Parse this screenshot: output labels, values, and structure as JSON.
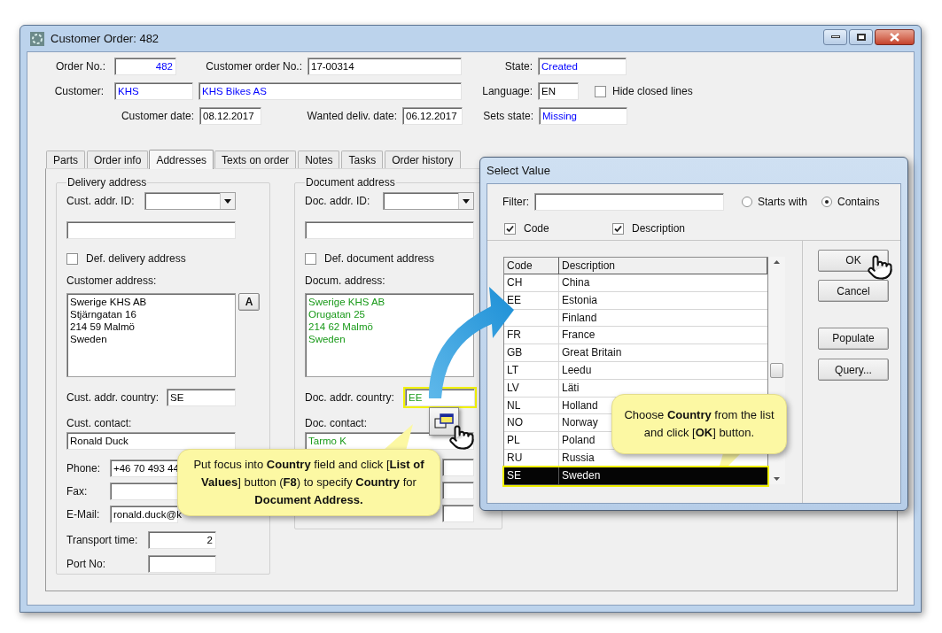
{
  "window": {
    "title": "Customer Order: 482"
  },
  "header": {
    "order_no": {
      "label": "Order No.:",
      "value": "482",
      "linked": true
    },
    "customer_order_no": {
      "label": "Customer order No.:",
      "value": "17-00314"
    },
    "state": {
      "label": "State:",
      "value": "Created",
      "linked": true
    },
    "customer": {
      "label": "Customer:",
      "code": "KHS",
      "name": "KHS Bikes AS",
      "linked": true
    },
    "language": {
      "label": "Language:",
      "value": "EN"
    },
    "hide_closed_lines": {
      "label": "Hide closed lines",
      "checked": false
    },
    "customer_date": {
      "label": "Customer date:",
      "value": "08.12.2017"
    },
    "wanted_delivery_date": {
      "label": "Wanted deliv. date:",
      "value": "06.12.2017"
    },
    "sets_state": {
      "label": "Sets state:",
      "value": "Missing",
      "linked": true
    }
  },
  "tabs": [
    {
      "label": "Parts",
      "selected": false
    },
    {
      "label": "Order info",
      "selected": false
    },
    {
      "label": "Addresses",
      "selected": true
    },
    {
      "label": "Texts on order",
      "selected": false
    },
    {
      "label": "Notes",
      "selected": false
    },
    {
      "label": "Tasks",
      "selected": false
    },
    {
      "label": "Order history",
      "selected": false
    }
  ],
  "delivery_address": {
    "title": "Delivery address",
    "addr_id": {
      "label": "Cust. addr. ID:"
    },
    "def_checkbox": {
      "label": "Def. delivery address",
      "checked": false
    },
    "address_label": "Customer address:",
    "address": {
      "lines": [
        "Swerige KHS AB",
        "Stjärngatan 16",
        "214 59 Malmö",
        "Sweden"
      ]
    },
    "address_button": "A",
    "country": {
      "label": "Cust. addr. country:",
      "value": "SE",
      "highlighted": false
    },
    "contact": {
      "label": "Cust. contact:",
      "value": "Ronald Duck"
    },
    "phone": {
      "label": "Phone:",
      "value": "+46 70 493 44"
    },
    "fax": {
      "label": "Fax:"
    },
    "email": {
      "label": "E-Mail:",
      "value": "ronald.duck@k"
    },
    "transport_time": {
      "label": "Transport time:",
      "value": "2"
    },
    "port_no": {
      "label": "Port No:"
    }
  },
  "document_address": {
    "title": "Document address",
    "addr_id": {
      "label": "Doc. addr. ID:"
    },
    "def_checkbox": {
      "label": "Def. document address",
      "checked": false
    },
    "address_label": "Docum. address:",
    "address": {
      "lines": [
        "Swerige KHS AB",
        "Orugatan 25",
        "214 62 Malmö",
        "Sweden"
      ],
      "inherited": true
    },
    "country": {
      "label": "Doc. addr. country:",
      "value": "EE",
      "inherited": true,
      "highlighted": true
    },
    "contact": {
      "label": "Doc. contact:",
      "value": "Tarmo K",
      "inherited": true
    }
  },
  "dialog": {
    "title": "Select Value",
    "filter": {
      "label": "Filter:"
    },
    "match_options": [
      {
        "label": "Starts with",
        "selected": false
      },
      {
        "label": "Contains",
        "selected": true
      }
    ],
    "search_in": [
      {
        "label": "Code",
        "checked": true
      },
      {
        "label": "Description",
        "checked": true
      }
    ],
    "table": {
      "columns": [
        "Code",
        "Description"
      ],
      "rows": [
        {
          "code": "CH",
          "description": "China",
          "selected": false
        },
        {
          "code": "EE",
          "description": "Estonia",
          "selected": false
        },
        {
          "description": "Finland",
          "selected": false
        },
        {
          "code": "FR",
          "description": "France",
          "selected": false
        },
        {
          "code": "GB",
          "description": "Great Britain",
          "selected": false
        },
        {
          "code": "LT",
          "description": "Leedu",
          "selected": false
        },
        {
          "code": "LV",
          "description": "Läti",
          "selected": false
        },
        {
          "code": "NL",
          "description": "Holland",
          "selected": false
        },
        {
          "code": "NO",
          "description": "Norway",
          "selected": false
        },
        {
          "code": "PL",
          "description": "Poland",
          "selected": false
        },
        {
          "code": "RU",
          "description": "Russia",
          "selected": false
        },
        {
          "code": "SE",
          "description": "Sweden",
          "selected": true
        }
      ]
    },
    "action_buttons": [
      "OK",
      "Cancel"
    ],
    "tool_buttons": [
      "Populate",
      "Query..."
    ]
  },
  "callouts": [
    {
      "text": "Put focus into **Country** field and click [**List of Values**] button (**F8**) to specify **Country** for **Document Address.**"
    },
    {
      "text": "Choose **Country** from the list and click [**OK**] button."
    }
  ]
}
